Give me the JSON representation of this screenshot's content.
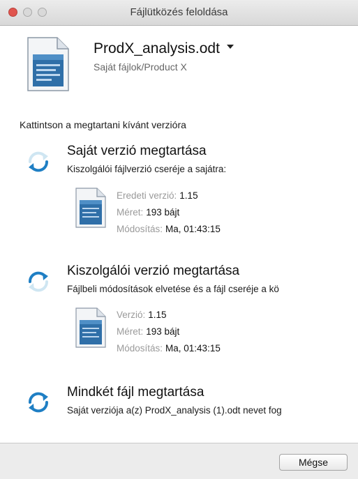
{
  "window": {
    "title": "Fájlütközés feloldása"
  },
  "file": {
    "name": "ProdX_analysis.odt",
    "path": "Saját fájlok/Product X"
  },
  "instruction": "Kattintson a megtartani kívánt verzióra",
  "options": [
    {
      "title": "Saját verzió megtartása",
      "description": "Kiszolgálói fájlverzió cseréje a sajátra:",
      "details": [
        {
          "key": "Eredeti verzió:",
          "value": "1.15"
        },
        {
          "key": "Méret:",
          "value": "193 bájt"
        },
        {
          "key": "Módosítás:",
          "value": "Ma, 01:43:15"
        }
      ]
    },
    {
      "title": "Kiszolgálói verzió megtartása",
      "description": "Fájlbeli módosítások elvetése és a fájl cseréje a kö",
      "details": [
        {
          "key": "Verzió:",
          "value": "1.15"
        },
        {
          "key": "Méret:",
          "value": "193 bájt"
        },
        {
          "key": "Módosítás:",
          "value": "Ma, 01:43:15"
        }
      ]
    },
    {
      "title": "Mindkét fájl megtartása",
      "description": "Saját verziója a(z) ProdX_analysis (1).odt nevet fog"
    }
  ],
  "footer": {
    "cancel_label": "Mégse"
  },
  "colors": {
    "sync_blue": "#1f7fc4",
    "sync_light": "#cfe6f2"
  }
}
